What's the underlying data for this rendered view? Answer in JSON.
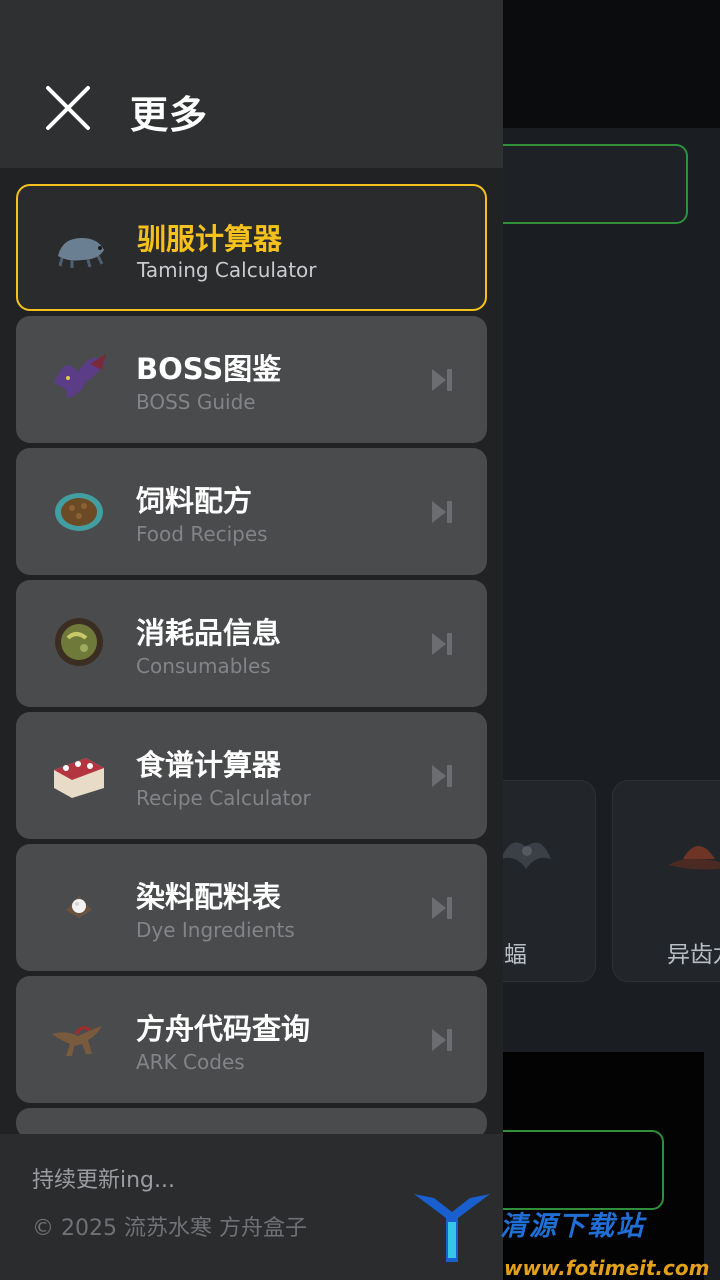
{
  "drawer": {
    "title": "更多",
    "items": [
      {
        "title": "驯服计算器",
        "subtitle": "Taming Calculator",
        "icon": "taming-creature-icon",
        "active": true
      },
      {
        "title": "BOSS图鉴",
        "subtitle": "BOSS Guide",
        "icon": "dragon-boss-icon"
      },
      {
        "title": "饲料配方",
        "subtitle": "Food Recipes",
        "icon": "kibble-icon"
      },
      {
        "title": "消耗品信息",
        "subtitle": "Consumables",
        "icon": "soup-bowl-icon"
      },
      {
        "title": "食谱计算器",
        "subtitle": "Recipe Calculator",
        "icon": "cake-icon"
      },
      {
        "title": "染料配料表",
        "subtitle": "Dye Ingredients",
        "icon": "dye-bowl-icon"
      },
      {
        "title": "方舟代码查询",
        "subtitle": "ARK Codes",
        "icon": "raptor-icon"
      }
    ],
    "footer": {
      "status": "持续更新ing...",
      "copyright": "© 2025 流苏水寒 方舟盒子"
    }
  },
  "background": {
    "cards": [
      {
        "label": "魔蝠"
      },
      {
        "label": "异齿龙"
      }
    ]
  },
  "watermark": {
    "text": "清源下载站",
    "url": "www.fotimeit.com"
  },
  "colors": {
    "accent": "#f5c21c",
    "green_border": "#2f8f3a",
    "drawer_bg": "#202224",
    "item_bg": "#4a4b4d"
  }
}
